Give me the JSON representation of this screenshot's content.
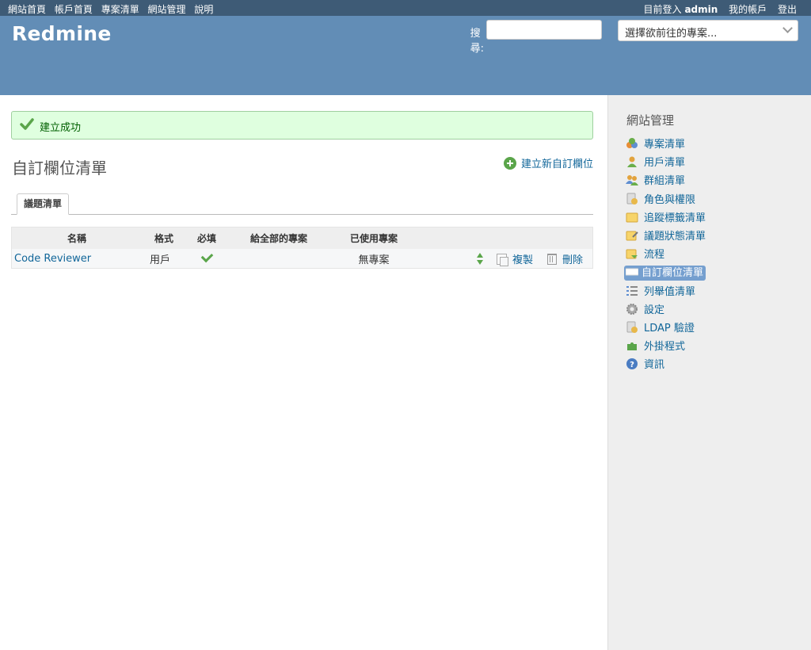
{
  "top_menu": {
    "items": [
      "網站首頁",
      "帳戶首頁",
      "專案清單",
      "網站管理",
      "說明"
    ],
    "logged_in_label": "目前登入",
    "user": "admin",
    "my_account": "我的帳戶",
    "logout": "登出"
  },
  "header": {
    "logo": "Redmine",
    "search_label": "搜尋:",
    "search_value": "",
    "project_select": "選擇欲前往的專案..."
  },
  "flash": {
    "text": "建立成功"
  },
  "page": {
    "title": "自訂欄位清單",
    "new_link": "建立新自訂欄位",
    "tab": "議題清單"
  },
  "table": {
    "headers": [
      "名稱",
      "格式",
      "必填",
      "給全部的專案",
      "已使用專案"
    ],
    "rows": [
      {
        "name": "Code Reviewer",
        "format": "用戶",
        "required": true,
        "for_all": false,
        "used_by": "無專案",
        "copy": "複製",
        "delete": "刪除"
      }
    ]
  },
  "sidebar": {
    "title": "網站管理",
    "items": [
      {
        "label": "專案清單",
        "icon": "projects-icon"
      },
      {
        "label": "用戶清單",
        "icon": "user-icon"
      },
      {
        "label": "群組清單",
        "icon": "group-icon"
      },
      {
        "label": "角色與權限",
        "icon": "roles-icon"
      },
      {
        "label": "追蹤標籤清單",
        "icon": "tracker-icon"
      },
      {
        "label": "議題狀態清單",
        "icon": "issue-status-icon"
      },
      {
        "label": "流程",
        "icon": "workflow-icon"
      },
      {
        "label": "自訂欄位清單",
        "icon": "custom-fields-icon",
        "selected": true
      },
      {
        "label": "列舉值清單",
        "icon": "list-icon"
      },
      {
        "label": "設定",
        "icon": "gear-icon"
      },
      {
        "label": "LDAP 驗證",
        "icon": "ldap-icon"
      },
      {
        "label": "外掛程式",
        "icon": "plugin-icon"
      },
      {
        "label": "資訊",
        "icon": "info-icon"
      }
    ]
  },
  "colors": {
    "top_menu": "#3e5b76",
    "header": "#628db6",
    "link": "#116699",
    "flash_bg": "#dfffdf",
    "sidebar_bg": "#eeeeee",
    "selected": "#759fcf"
  }
}
